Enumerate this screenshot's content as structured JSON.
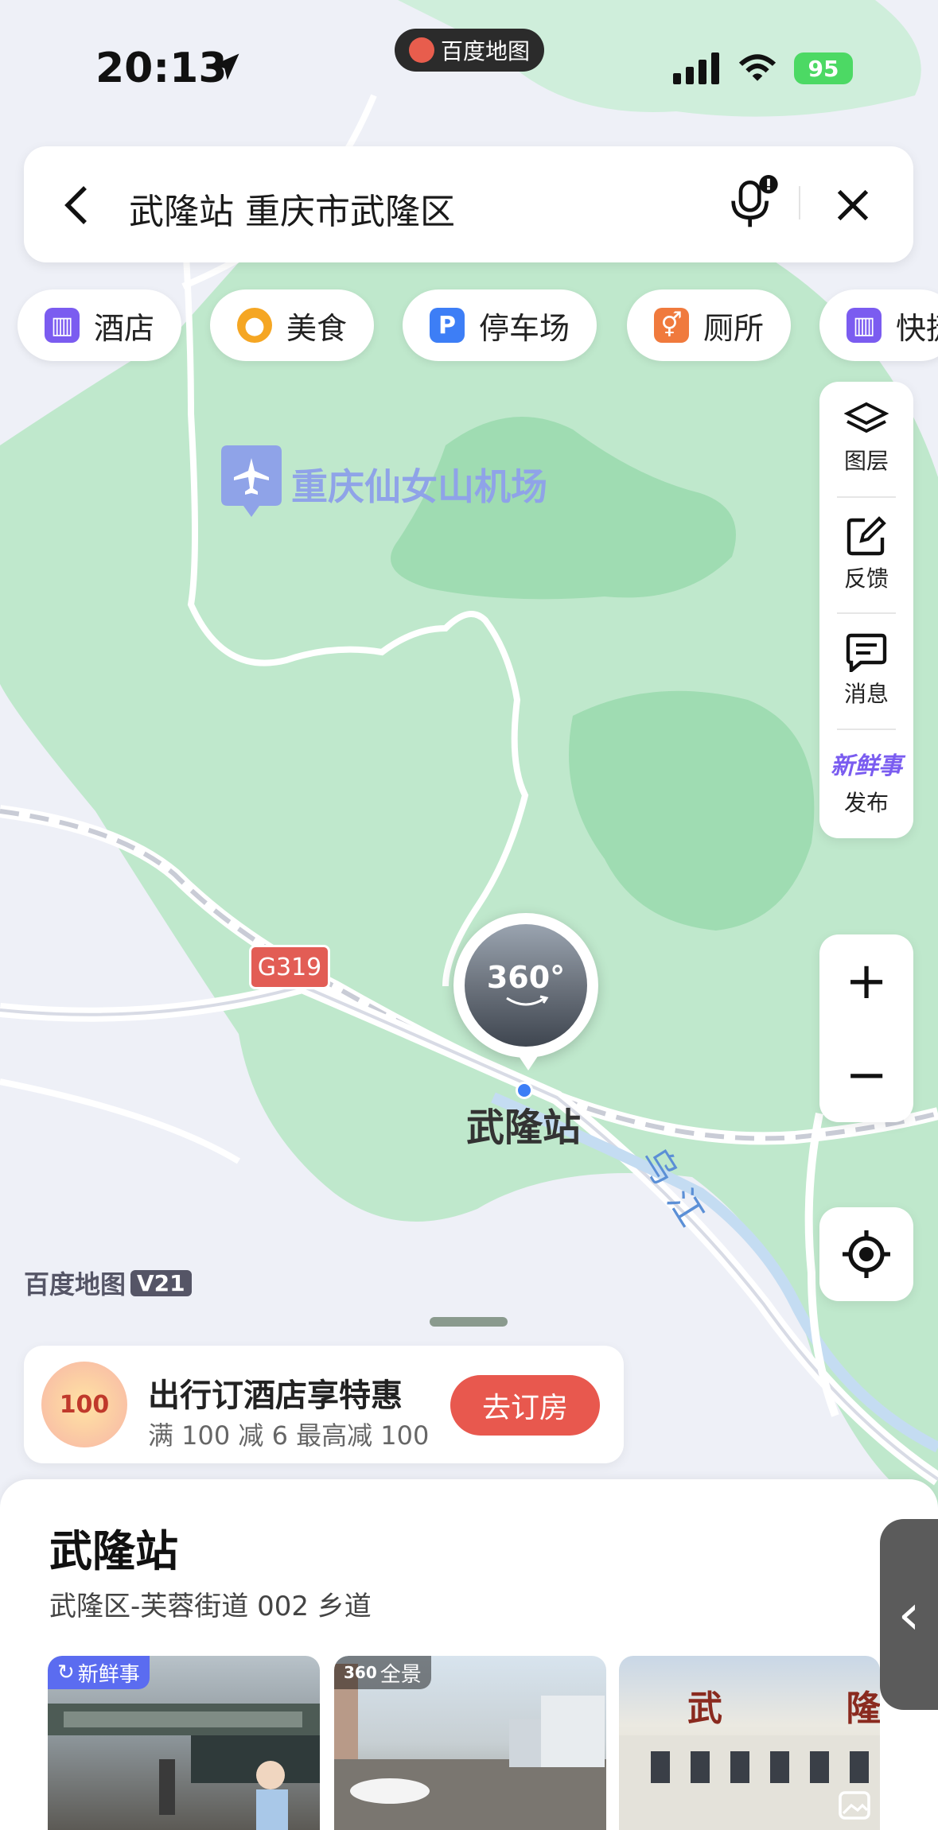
{
  "status_bar": {
    "time": "20:13",
    "app_name": "百度地图",
    "battery": "95"
  },
  "search": {
    "query": "武隆站 重庆市武隆区"
  },
  "categories": [
    {
      "label": "酒店",
      "icon": "hotel-icon",
      "color": "#7b5cf0"
    },
    {
      "label": "美食",
      "icon": "food-icon",
      "color": "#f5a623"
    },
    {
      "label": "停车场",
      "icon": "parking-icon",
      "color": "#3d7ef6"
    },
    {
      "label": "厕所",
      "icon": "toilet-icon",
      "color": "#f07a3d"
    },
    {
      "label": "快捷",
      "icon": "hotel-icon",
      "color": "#7b5cf0"
    }
  ],
  "tools": {
    "layers": "图层",
    "feedback": "反馈",
    "messages": "消息",
    "publish": "发布",
    "publish_badge": "新鲜事"
  },
  "zoom": {
    "in": "+",
    "out": "−"
  },
  "map": {
    "airport_label": "重庆仙女山机场",
    "station_label": "武隆站",
    "river_label": "乌江",
    "road_label": "G319",
    "pin_label": "360°",
    "watermark": "百度地图",
    "watermark_version": "V21"
  },
  "promo": {
    "title": "出行订酒店享特惠",
    "subtitle": "满 100 减 6  最高减 100",
    "button": "去订房",
    "badge": "100"
  },
  "place": {
    "name": "武隆站",
    "address": "武隆区-芙蓉街道 002 乡道",
    "photos": [
      {
        "tag": "新鲜事",
        "tag_color": "#5b6cf0"
      },
      {
        "tag": "全景",
        "tag_badge": "360",
        "tag_color": "rgba(0,0,0,0.45)"
      },
      {
        "sign": "武 隆"
      }
    ]
  },
  "colors": {
    "park_green": "#bfe8cc",
    "park_dark": "#9fdcb2",
    "accent": "#e8584e"
  }
}
